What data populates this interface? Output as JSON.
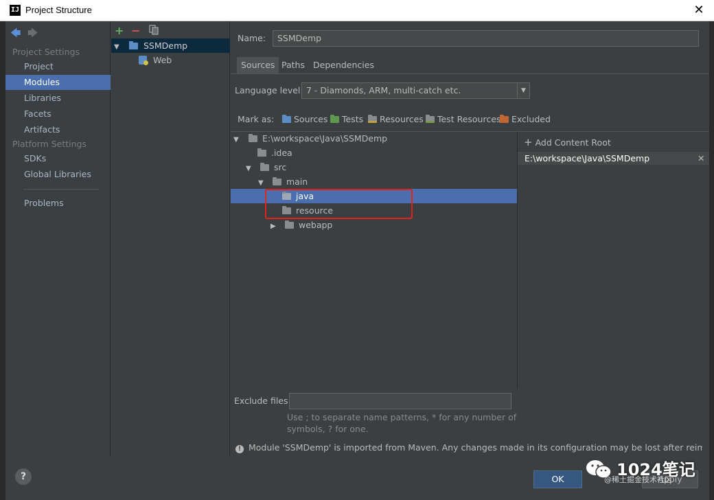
{
  "window": {
    "title": "Project Structure",
    "close_label": "✕"
  },
  "sidebar": {
    "project_settings_header": "Project Settings",
    "project_items": [
      {
        "label": "Project",
        "selected": false
      },
      {
        "label": "Modules",
        "selected": true
      },
      {
        "label": "Libraries",
        "selected": false
      },
      {
        "label": "Facets",
        "selected": false
      },
      {
        "label": "Artifacts",
        "selected": false
      }
    ],
    "platform_settings_header": "Platform Settings",
    "platform_items": [
      {
        "label": "SDKs"
      },
      {
        "label": "Global Libraries"
      }
    ],
    "problems_label": "Problems"
  },
  "modules": {
    "add_label": "+",
    "remove_label": "−",
    "items": [
      {
        "label": "SSMDemp",
        "selected": true
      },
      {
        "label": "Web",
        "selected": false
      }
    ]
  },
  "detail": {
    "name_label": "Name:",
    "name_value": "SSMDemp",
    "tabs": [
      {
        "label": "Sources",
        "active": true
      },
      {
        "label": "Paths",
        "active": false
      },
      {
        "label": "Dependencies",
        "active": false
      }
    ],
    "language_level_label": "Language level:",
    "language_level_value": "7 - Diamonds, ARM, multi-catch etc.",
    "mark_as_label": "Mark as:",
    "mark_as_items": [
      {
        "label": "Sources",
        "icon": "sources-folder-icon"
      },
      {
        "label": "Tests",
        "icon": "tests-folder-icon"
      },
      {
        "label": "Resources",
        "icon": "resources-folder-icon"
      },
      {
        "label": "Test Resources",
        "icon": "test-resources-folder-icon"
      },
      {
        "label": "Excluded",
        "icon": "excluded-folder-icon"
      }
    ],
    "tree": [
      {
        "label": "E:\\workspace\\Java\\SSMDemp",
        "expanded": true,
        "selected": false
      },
      {
        "label": ".idea",
        "expanded": false,
        "selected": false
      },
      {
        "label": "src",
        "expanded": true,
        "selected": false
      },
      {
        "label": "main",
        "expanded": true,
        "selected": false
      },
      {
        "label": "java",
        "expanded": false,
        "selected": true
      },
      {
        "label": "resource",
        "expanded": false,
        "selected": false
      },
      {
        "label": "webapp",
        "expanded": false,
        "selected": false
      }
    ],
    "add_content_root_label": "Add Content Root",
    "content_root_path": "E:\\workspace\\Java\\SSMDemp",
    "exclude_files_label": "Exclude files:",
    "exclude_files_value": "",
    "exclude_hint_line1": "Use ; to separate name patterns, * for any number of",
    "exclude_hint_line2": "symbols, ? for one.",
    "info_message": "Module 'SSMDemp' is imported from Maven. Any changes made in its configuration may be lost after reimporting."
  },
  "footer": {
    "help_label": "?",
    "ok_label": "OK",
    "apply_label": "Apply"
  },
  "watermark": {
    "text": "1024笔记",
    "sub": "@稀土掘金技术社区"
  }
}
